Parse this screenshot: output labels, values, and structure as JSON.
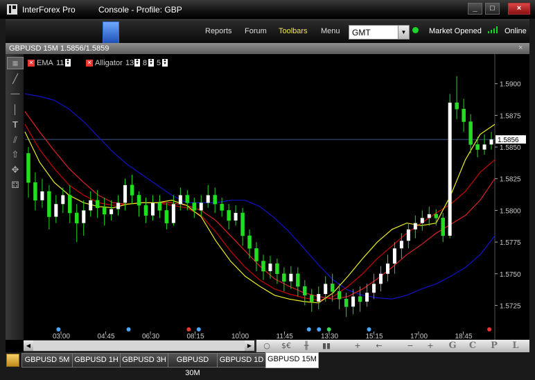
{
  "window": {
    "app_title": "InterForex Pro",
    "console_title": "Console - Profile: GBP",
    "buttons": [
      "_",
      "□",
      "×"
    ]
  },
  "nav": {
    "links": [
      "Reports",
      "Forum",
      "Toolbars",
      "Menu"
    ],
    "timezone": "GMT",
    "market_status": "Market Opened",
    "connection": "Online"
  },
  "chart": {
    "header_title": "GBPUSD 15M 1.5856/1.5859",
    "close_glyph": "×",
    "indicators": [
      {
        "name": "EMA",
        "params": [
          "11"
        ]
      },
      {
        "name": "Alligator",
        "params": [
          "13",
          "8",
          "5"
        ]
      }
    ],
    "current_price": "1.5856",
    "colors": {
      "background": "#000000",
      "bull": "#22dd22",
      "ema": "#1111cc",
      "jaw": "#dd2222",
      "teeth": "#cc0000",
      "lips": "#eeee22",
      "price_line": "#3a5a8a"
    }
  },
  "chart_data": {
    "type": "candlestick",
    "y_ticks": [
      "1.5900",
      "1.5875",
      "1.5850",
      "1.5825",
      "1.5800",
      "1.5775",
      "1.5750",
      "1.5725"
    ],
    "x_ticks": [
      "03:00",
      "04:45",
      "06:30",
      "08:15",
      "10:00",
      "11:45",
      "13:30",
      "15:15",
      "17:00",
      "18:45"
    ],
    "ylim": [
      1.5711,
      1.5919
    ],
    "candles": [
      [
        1.5845,
        1.5822,
        1.585,
        1.581
      ],
      [
        1.5822,
        1.5808,
        1.583,
        1.58
      ],
      [
        1.5808,
        1.5815,
        1.5825,
        1.5802
      ],
      [
        1.5815,
        1.5795,
        1.582,
        1.5785
      ],
      [
        1.5795,
        1.5805,
        1.5812,
        1.579
      ],
      [
        1.5805,
        1.5812,
        1.5818,
        1.5798
      ],
      [
        1.5812,
        1.5798,
        1.582,
        1.579
      ],
      [
        1.5798,
        1.579,
        1.5805,
        1.5775
      ],
      [
        1.579,
        1.58,
        1.5808,
        1.578
      ],
      [
        1.58,
        1.5808,
        1.5815,
        1.5795
      ],
      [
        1.5808,
        1.5802,
        1.5816,
        1.5794
      ],
      [
        1.5802,
        1.5797,
        1.581,
        1.5788
      ],
      [
        1.5797,
        1.5801,
        1.5808,
        1.5792
      ],
      [
        1.5801,
        1.5806,
        1.5812,
        1.5796
      ],
      [
        1.5806,
        1.582,
        1.5825,
        1.58
      ],
      [
        1.582,
        1.5812,
        1.5828,
        1.5805
      ],
      [
        1.5812,
        1.5804,
        1.5815,
        1.5795
      ],
      [
        1.5804,
        1.5796,
        1.581,
        1.579
      ],
      [
        1.5796,
        1.5806,
        1.5812,
        1.5792
      ],
      [
        1.5806,
        1.58,
        1.5812,
        1.5794
      ],
      [
        1.58,
        1.579,
        1.5806,
        1.5785
      ],
      [
        1.579,
        1.5805,
        1.5812,
        1.5788
      ],
      [
        1.5805,
        1.5812,
        1.5818,
        1.58
      ],
      [
        1.5812,
        1.5806,
        1.5816,
        1.58
      ],
      [
        1.5806,
        1.58,
        1.581,
        1.5794
      ],
      [
        1.58,
        1.5806,
        1.5812,
        1.5795
      ],
      [
        1.5806,
        1.5812,
        1.582,
        1.5802
      ],
      [
        1.5812,
        1.5805,
        1.5818,
        1.5798
      ],
      [
        1.5805,
        1.58,
        1.581,
        1.5795
      ],
      [
        1.58,
        1.5792,
        1.5805,
        1.5785
      ],
      [
        1.5792,
        1.5798,
        1.5804,
        1.5788
      ],
      [
        1.5798,
        1.578,
        1.5802,
        1.5772
      ],
      [
        1.578,
        1.577,
        1.5785,
        1.5762
      ],
      [
        1.577,
        1.576,
        1.5775,
        1.5752
      ],
      [
        1.576,
        1.5752,
        1.5765,
        1.5745
      ],
      [
        1.5752,
        1.5758,
        1.5764,
        1.5746
      ],
      [
        1.5758,
        1.575,
        1.5762,
        1.5742
      ],
      [
        1.575,
        1.5744,
        1.5755,
        1.5736
      ],
      [
        1.5744,
        1.575,
        1.5756,
        1.5738
      ],
      [
        1.575,
        1.574,
        1.5755,
        1.5732
      ],
      [
        1.574,
        1.5733,
        1.5745,
        1.5725
      ],
      [
        1.5733,
        1.5728,
        1.5738,
        1.572
      ],
      [
        1.5728,
        1.5734,
        1.574,
        1.5722
      ],
      [
        1.5734,
        1.5742,
        1.5748,
        1.5728
      ],
      [
        1.5742,
        1.5736,
        1.575,
        1.5728
      ],
      [
        1.5736,
        1.573,
        1.5742,
        1.5722
      ],
      [
        1.573,
        1.5724,
        1.5735,
        1.5716
      ],
      [
        1.5724,
        1.5732,
        1.5738,
        1.5718
      ],
      [
        1.5732,
        1.5728,
        1.574,
        1.572
      ],
      [
        1.5728,
        1.5735,
        1.5742,
        1.5724
      ],
      [
        1.5735,
        1.5742,
        1.575,
        1.573
      ],
      [
        1.5742,
        1.575,
        1.5756,
        1.5736
      ],
      [
        1.575,
        1.5758,
        1.5765,
        1.5744
      ],
      [
        1.5758,
        1.577,
        1.5775,
        1.575
      ],
      [
        1.577,
        1.5776,
        1.5782,
        1.5762
      ],
      [
        1.5776,
        1.5785,
        1.579,
        1.577
      ],
      [
        1.5785,
        1.579,
        1.5796,
        1.5778
      ],
      [
        1.579,
        1.5794,
        1.58,
        1.5784
      ],
      [
        1.5794,
        1.5797,
        1.5803,
        1.5788
      ],
      [
        1.5797,
        1.5794,
        1.5801,
        1.5788
      ],
      [
        1.5794,
        1.578,
        1.5798,
        1.5775
      ],
      [
        1.578,
        1.5885,
        1.5892,
        1.5778
      ],
      [
        1.5885,
        1.588,
        1.5906,
        1.5872
      ],
      [
        1.588,
        1.587,
        1.5888,
        1.5862
      ],
      [
        1.587,
        1.5852,
        1.5876,
        1.5845
      ],
      [
        1.5852,
        1.5848,
        1.5858,
        1.5842
      ],
      [
        1.5848,
        1.5852,
        1.586,
        1.5844
      ],
      [
        1.5852,
        1.5856,
        1.5862,
        1.5848
      ]
    ],
    "lines": {
      "ema": [
        1.5892,
        1.589,
        1.5887,
        1.588,
        1.587,
        1.5858,
        1.5846,
        1.5836,
        1.5828,
        1.582,
        1.5812,
        1.5806,
        1.5806,
        1.5806,
        1.5808,
        1.5808,
        1.5803,
        1.5794,
        1.5783,
        1.577,
        1.5757,
        1.5745,
        1.5737,
        1.5733,
        1.5731,
        1.573,
        1.5733,
        1.5738,
        1.5742,
        1.5748,
        1.5755,
        1.5765,
        1.578
      ],
      "jaw": [
        1.5878,
        1.5862,
        1.5847,
        1.5833,
        1.5822,
        1.5812,
        1.5806,
        1.5805,
        1.5806,
        1.5806,
        1.5806,
        1.5804,
        1.58,
        1.5792,
        1.578,
        1.5768,
        1.5756,
        1.5746,
        1.574,
        1.5735,
        1.5732,
        1.573,
        1.5732,
        1.5738,
        1.5746,
        1.5755,
        1.5765,
        1.5773,
        1.5782,
        1.5789,
        1.5796,
        1.5808,
        1.5825
      ],
      "teeth": [
        1.5868,
        1.5848,
        1.5833,
        1.582,
        1.5812,
        1.5806,
        1.5804,
        1.5805,
        1.5806,
        1.5806,
        1.5804,
        1.5802,
        1.5796,
        1.5783,
        1.5768,
        1.5755,
        1.5745,
        1.5738,
        1.5734,
        1.5731,
        1.5729,
        1.5732,
        1.574,
        1.575,
        1.5762,
        1.5772,
        1.5782,
        1.579,
        1.5798,
        1.5805,
        1.5815,
        1.583,
        1.584
      ],
      "lips": [
        1.5862,
        1.5838,
        1.5822,
        1.5812,
        1.5806,
        1.5803,
        1.5802,
        1.5805,
        1.5806,
        1.5806,
        1.5808,
        1.5804,
        1.5795,
        1.5776,
        1.576,
        1.5748,
        1.574,
        1.5733,
        1.573,
        1.5728,
        1.5727,
        1.5735,
        1.5748,
        1.5762,
        1.5775,
        1.5785,
        1.579,
        1.5788,
        1.579,
        1.5812,
        1.584,
        1.586,
        1.5868
      ]
    },
    "markers": [
      {
        "x_index": 3,
        "color": "#4aa8ff"
      },
      {
        "x_index": 10,
        "color": "#4aa8ff"
      },
      {
        "x_index": 16,
        "color": "#e33"
      },
      {
        "x_index": 17,
        "color": "#4aa8ff"
      },
      {
        "x_index": 28,
        "color": "#4aa8ff"
      },
      {
        "x_index": 29,
        "color": "#4aa8ff"
      },
      {
        "x_index": 30,
        "color": "#3bd65a"
      },
      {
        "x_index": 34,
        "color": "#4aa8ff"
      },
      {
        "x_index": 46,
        "color": "#e33"
      }
    ]
  },
  "bottom_toolbar": {
    "tools": [
      {
        "name": "cursor-circle-icon",
        "glyph": "○"
      },
      {
        "name": "currency-icon",
        "glyph": "$€"
      },
      {
        "name": "candles-icon",
        "glyph": "╫"
      },
      {
        "name": "volume-icon",
        "glyph": "▮▮"
      },
      {
        "name": "crosshair-icon",
        "glyph": "+"
      },
      {
        "name": "arrow-left-icon",
        "glyph": "←"
      },
      {
        "name": "zoom-out-icon",
        "glyph": "−"
      },
      {
        "name": "zoom-in-icon",
        "glyph": "+"
      },
      {
        "name": "letter-g",
        "glyph": "G"
      },
      {
        "name": "letter-c",
        "glyph": "C"
      },
      {
        "name": "letter-p",
        "glyph": "P"
      },
      {
        "name": "letter-l",
        "glyph": "L"
      }
    ]
  },
  "tabs": [
    "GBPUSD 5M",
    "GBPUSD 1H",
    "GBPUSD 3H",
    "GBPUSD 30M",
    "GBPUSD 1D",
    "GBPUSD 15M"
  ],
  "active_tab": "GBPUSD 15M"
}
